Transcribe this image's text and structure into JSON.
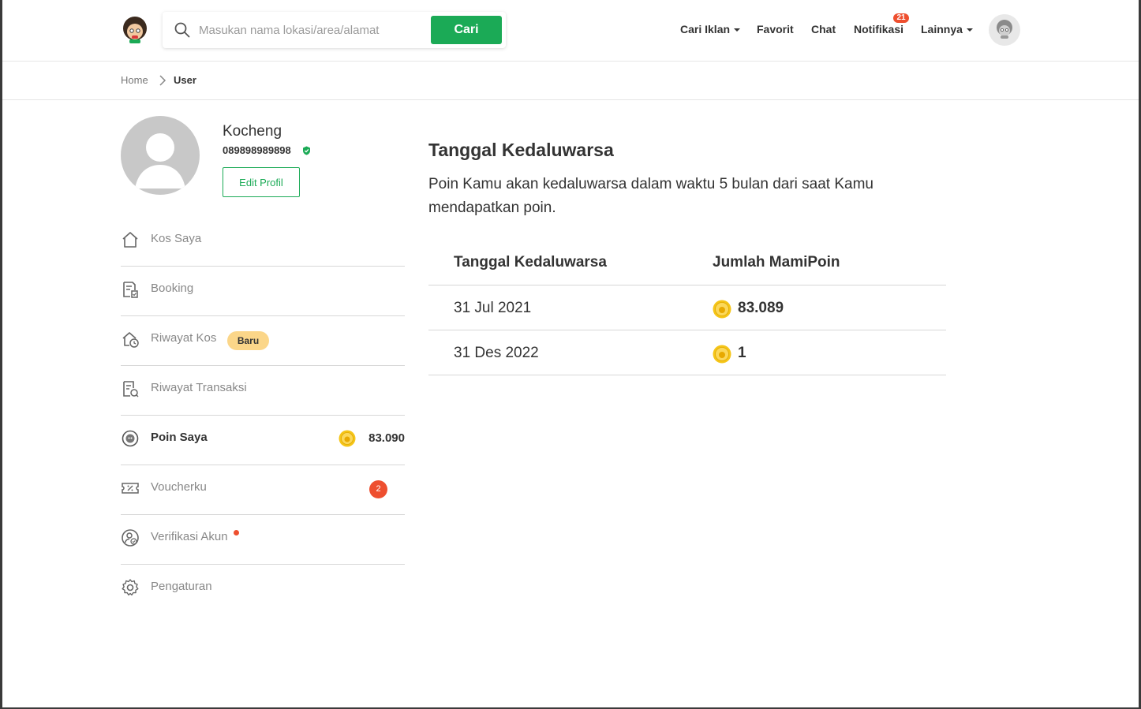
{
  "header": {
    "search": {
      "placeholder": "Masukan nama lokasi/area/alamat",
      "value": "",
      "button_label": "Cari"
    },
    "nav": {
      "cari_iklan": "Cari Iklan",
      "favorit": "Favorit",
      "chat": "Chat",
      "notifikasi": "Notifikasi",
      "notifikasi_count": "21",
      "lainnya": "Lainnya"
    }
  },
  "breadcrumb": {
    "home": "Home",
    "current": "User"
  },
  "profile": {
    "name": "Kocheng",
    "phone": "089898989898",
    "edit_label": "Edit Profil"
  },
  "sidebar": {
    "items": [
      {
        "label": "Kos Saya",
        "icon": "house-icon"
      },
      {
        "label": "Booking",
        "icon": "booking-icon"
      },
      {
        "label": "Riwayat Kos",
        "icon": "history-home-icon",
        "badge": "Baru"
      },
      {
        "label": "Riwayat Transaksi",
        "icon": "transaction-icon"
      },
      {
        "label": "Poin Saya",
        "icon": "poin-icon",
        "value": "83.090"
      },
      {
        "label": "Voucherku",
        "icon": "voucher-icon",
        "count": "2"
      },
      {
        "label": "Verifikasi Akun",
        "icon": "verify-user-icon"
      },
      {
        "label": "Pengaturan",
        "icon": "gear-icon"
      }
    ]
  },
  "main": {
    "title": "Tanggal Kedaluwarsa",
    "description": "Poin Kamu akan kedaluwarsa dalam waktu 5 bulan dari saat Kamu mendapatkan poin.",
    "table": {
      "headers": [
        "Tanggal Kedaluwarsa",
        "Jumlah MamiPoin"
      ],
      "rows": [
        {
          "date": "31 Jul 2021",
          "amount": "83.089"
        },
        {
          "date": "31 Des 2022",
          "amount": "1"
        }
      ]
    }
  },
  "colors": {
    "brand_green": "#1baa56",
    "badge_red": "#ee4f2f",
    "badge_yellow": "#fbd689",
    "coin_gold": "#f5c518"
  }
}
